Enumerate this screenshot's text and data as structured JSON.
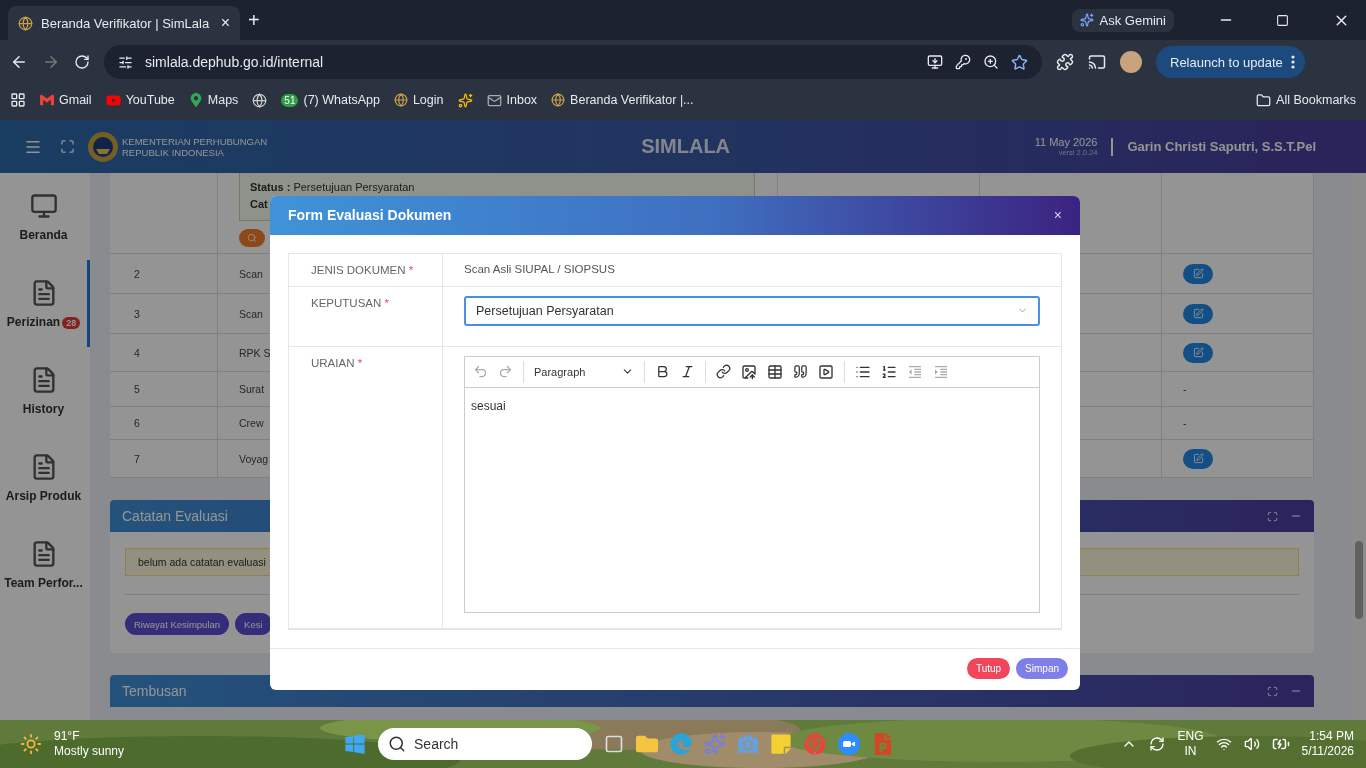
{
  "browser": {
    "tab": {
      "title": "Beranda Verifikator | SimLala",
      "close": "×"
    },
    "new_tab": "+",
    "ask_gemini": "Ask Gemini",
    "address": "simlala.dephub.go.id/internal",
    "relaunch": "Relaunch to update",
    "bookmarks": [
      {
        "kind": "gmail",
        "label": "Gmail"
      },
      {
        "kind": "youtube",
        "label": "YouTube"
      },
      {
        "kind": "maps",
        "label": "Maps"
      },
      {
        "kind": "globe"
      },
      {
        "kind": "whatsapp",
        "badge": "51",
        "label": "(7) WhatsApp"
      },
      {
        "kind": "site",
        "label": "Login"
      },
      {
        "kind": "pinwheel"
      },
      {
        "kind": "mail",
        "label": "Inbox"
      },
      {
        "kind": "site",
        "label": "Beranda Verifikator |..."
      }
    ],
    "all_bookmarks": "All Bookmarks"
  },
  "app_header": {
    "org_line_1": "KEMENTERIAN PERHUBUNGAN",
    "org_line_2": "REPUBLIK INDONESIA",
    "title": "SIMLALA",
    "date": "11 May 2026",
    "version": "versi 2.0.24",
    "user": "Garin Christi Saputri, S.S.T.Pel"
  },
  "sidebar": {
    "items": [
      {
        "kind": "monitor",
        "label": "Beranda",
        "selected": false
      },
      {
        "kind": "doc",
        "label": "Perizinan",
        "badge": "28",
        "selected": true
      },
      {
        "kind": "doc",
        "label": "History",
        "selected": false
      },
      {
        "kind": "doc",
        "label": "Arsip Produk",
        "selected": false
      },
      {
        "kind": "doc",
        "label": "Team Perfor...",
        "selected": false
      }
    ]
  },
  "table": {
    "note": {
      "status_label": "Status :",
      "status": "Persetujuan Persyaratan",
      "catatan": "Cat"
    },
    "rows": [
      {
        "no": "2",
        "name": "Scan",
        "action": {
          "kind": "edit"
        }
      },
      {
        "no": "3",
        "name": "Scan",
        "action": {
          "kind": "edit"
        }
      },
      {
        "no": "4",
        "name": "RPK S",
        "action": {
          "kind": "edit"
        }
      },
      {
        "no": "5",
        "name": "Surat",
        "action": {
          "kind": "text",
          "text": "-"
        }
      },
      {
        "no": "6",
        "name": "Crew",
        "action": {
          "kind": "text",
          "text": "-"
        }
      },
      {
        "no": "7",
        "name": "Voyag",
        "action": {
          "kind": "edit"
        }
      }
    ]
  },
  "catatan_card": {
    "title": "Catatan Evaluasi",
    "alert": "belum ada catatan evaluasi",
    "buttons": [
      "Riwayat Kesimpulan",
      "Kesi"
    ]
  },
  "tembusan_card": {
    "title": "Tembusan"
  },
  "modal": {
    "title": "Form Evaluasi Dokumen",
    "close": "×",
    "fields": [
      {
        "kind": "text",
        "label": "JENIS DOKUMEN",
        "required_mark": "*",
        "value": "Scan Asli SIUPAL / SIOPSUS"
      },
      {
        "kind": "select",
        "label": "KEPUTUSAN",
        "required_mark": "*",
        "value": "Persetujuan Persyaratan"
      },
      {
        "kind": "editor",
        "label": "URAIAN",
        "required_mark": "*",
        "style_menu": "Paragraph",
        "value": "sesuai"
      }
    ],
    "buttons": [
      {
        "kind": "danger",
        "label": "Tutup"
      },
      {
        "kind": "primary",
        "label": "Simpan"
      }
    ]
  },
  "taskbar": {
    "weather_temp": "91°F",
    "weather_text": "Mostly sunny",
    "search_placeholder": "Search",
    "language": "ENG",
    "region": "IN",
    "time": "1:54 PM",
    "date": "5/11/2026"
  }
}
